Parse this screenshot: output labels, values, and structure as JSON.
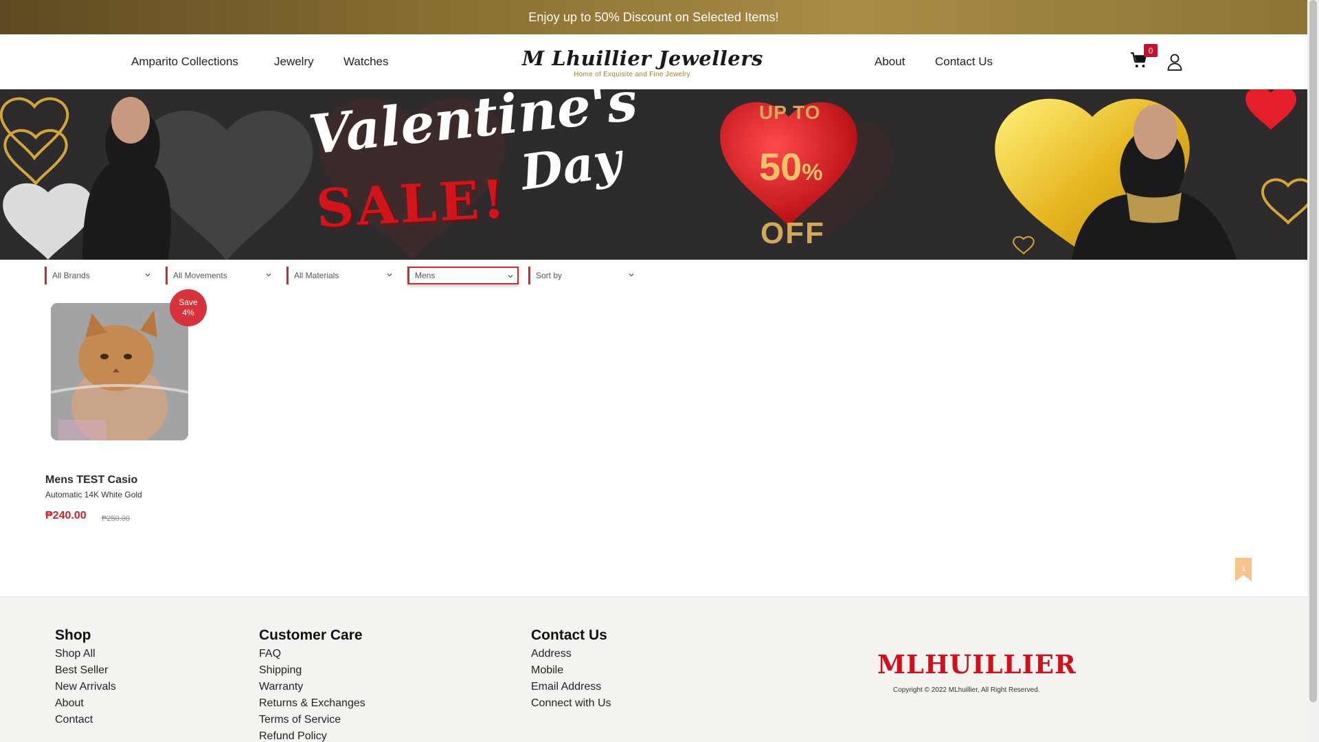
{
  "announcement": {
    "text": "Enjoy up to 50% Discount on Selected Items!"
  },
  "header": {
    "nav_left": [
      "Amparito Collections",
      "Jewelry",
      "Watches"
    ],
    "nav_right": [
      "About",
      "Contact Us"
    ],
    "logo": {
      "main": "M Lhuillier Jewellers",
      "sub": "Home of Exquisite and Fine Jewelry"
    },
    "cart_count": "0"
  },
  "hero": {
    "title_1": "Valentine's",
    "title_2": "Day",
    "sale": "SALE!",
    "up_to": "UP TO",
    "percent": "50",
    "percent_sign": "%",
    "off": "OFF"
  },
  "filters": {
    "brands": "All Brands",
    "movements": "All Movements",
    "materials": "All Materials",
    "gender": "Mens",
    "sort": "Sort by"
  },
  "product": {
    "save_label": "Save",
    "save_pct": "4%",
    "name": "Mens TEST Casio",
    "description": "Automatic 14K White Gold",
    "price": "₱240.00",
    "old_price": "₱250.00",
    "bookmark_count": "1"
  },
  "footer": {
    "shop": {
      "title": "Shop",
      "links": [
        "Shop All",
        "Best Seller",
        "New Arrivals",
        "About",
        "Contact"
      ]
    },
    "care": {
      "title": "Customer Care",
      "links": [
        "FAQ",
        "Shipping",
        "Warranty",
        "Returns & Exchanges",
        "Terms of Service",
        "Refund Policy"
      ]
    },
    "contact": {
      "title": "Contact Us",
      "links": [
        "Address",
        "Mobile",
        "Email Address",
        "Connect with Us"
      ]
    },
    "brand_logo": "MLHUILLIER",
    "copyright": "Copyright © 2022 MLhuillier, All Right Reserved."
  },
  "colors": {
    "accent_red": "#d0282e",
    "gold": "#8a7032",
    "footer_bg": "#f5f3ef"
  },
  "icons": [
    "cart-icon",
    "user-icon",
    "chevron-down-icon",
    "bookmark-icon"
  ]
}
